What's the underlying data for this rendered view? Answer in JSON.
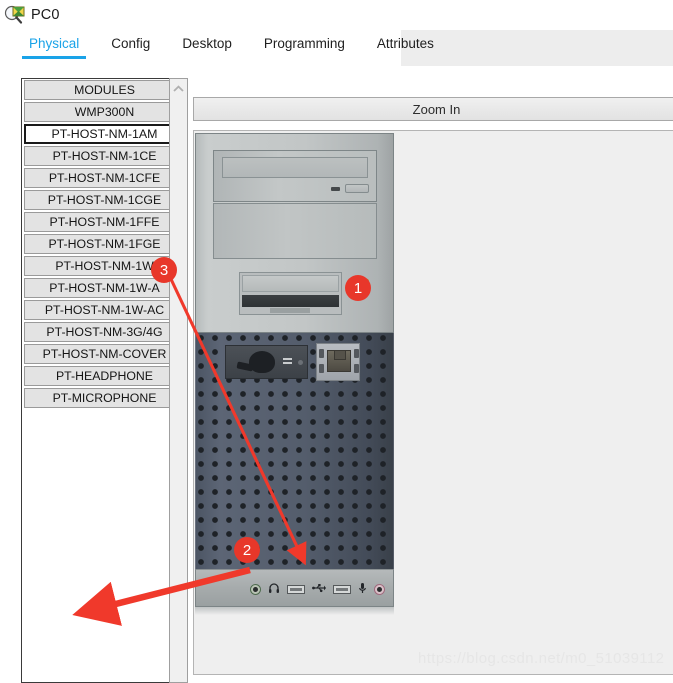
{
  "window": {
    "title": "PC0",
    "icon": "packet-tracer-device-icon"
  },
  "tabs": [
    {
      "label": "Physical",
      "active": true
    },
    {
      "label": "Config",
      "active": false
    },
    {
      "label": "Desktop",
      "active": false
    },
    {
      "label": "Programming",
      "active": false
    },
    {
      "label": "Attributes",
      "active": false
    }
  ],
  "modules_panel": {
    "header": "MODULES",
    "items": [
      {
        "label": "MODULES",
        "selected": false,
        "is_header": true
      },
      {
        "label": "WMP300N",
        "selected": false
      },
      {
        "label": "PT-HOST-NM-1AM",
        "selected": true
      },
      {
        "label": "PT-HOST-NM-1CE",
        "selected": false
      },
      {
        "label": "PT-HOST-NM-1CFE",
        "selected": false
      },
      {
        "label": "PT-HOST-NM-1CGE",
        "selected": false
      },
      {
        "label": "PT-HOST-NM-1FFE",
        "selected": false
      },
      {
        "label": "PT-HOST-NM-1FGE",
        "selected": false
      },
      {
        "label": "PT-HOST-NM-1W",
        "selected": false
      },
      {
        "label": "PT-HOST-NM-1W-A",
        "selected": false
      },
      {
        "label": "PT-HOST-NM-1W-AC",
        "selected": false
      },
      {
        "label": "PT-HOST-NM-3G/4G",
        "selected": false
      },
      {
        "label": "PT-HOST-NM-COVER",
        "selected": false
      },
      {
        "label": "PT-HEADPHONE",
        "selected": false
      },
      {
        "label": "PT-MICROPHONE",
        "selected": false
      }
    ],
    "scrollbar": {
      "up_arrow": "chevron-up-icon"
    }
  },
  "right_panel": {
    "zoom_in_label": "Zoom In"
  },
  "annotations": [
    {
      "id": "1",
      "label": "1",
      "target": "power-led"
    },
    {
      "id": "2",
      "label": "2",
      "target": "modem-module"
    },
    {
      "id": "3",
      "label": "3",
      "target": "module-list-wireless-entry"
    }
  ],
  "device": {
    "name": "pc-chassis-front-view",
    "ports": [
      {
        "name": "optical-drive-bay"
      },
      {
        "name": "blank-drive-bay"
      },
      {
        "name": "floppy-drive-bay"
      },
      {
        "name": "power-led"
      },
      {
        "name": "modem-module-slot"
      },
      {
        "name": "ethernet-rj45-port"
      },
      {
        "name": "audio-line-out-jack"
      },
      {
        "name": "headphone-jack"
      },
      {
        "name": "usb-port-1"
      },
      {
        "name": "usb-port-2"
      },
      {
        "name": "microphone-jack"
      }
    ],
    "io_glyphs": {
      "headphone": "Ω",
      "usb": "usb-icon",
      "microphone": "mic-icon"
    }
  },
  "colors": {
    "accent": "#1aa3e8",
    "annotation_red": "#e8372a",
    "led_yellow": "#cfe04a",
    "chassis_gray": "#c2c6c6",
    "mesh_slate": "#545d6c"
  },
  "watermark": {
    "text": "https://blog.csdn.net/m0_51039112"
  }
}
